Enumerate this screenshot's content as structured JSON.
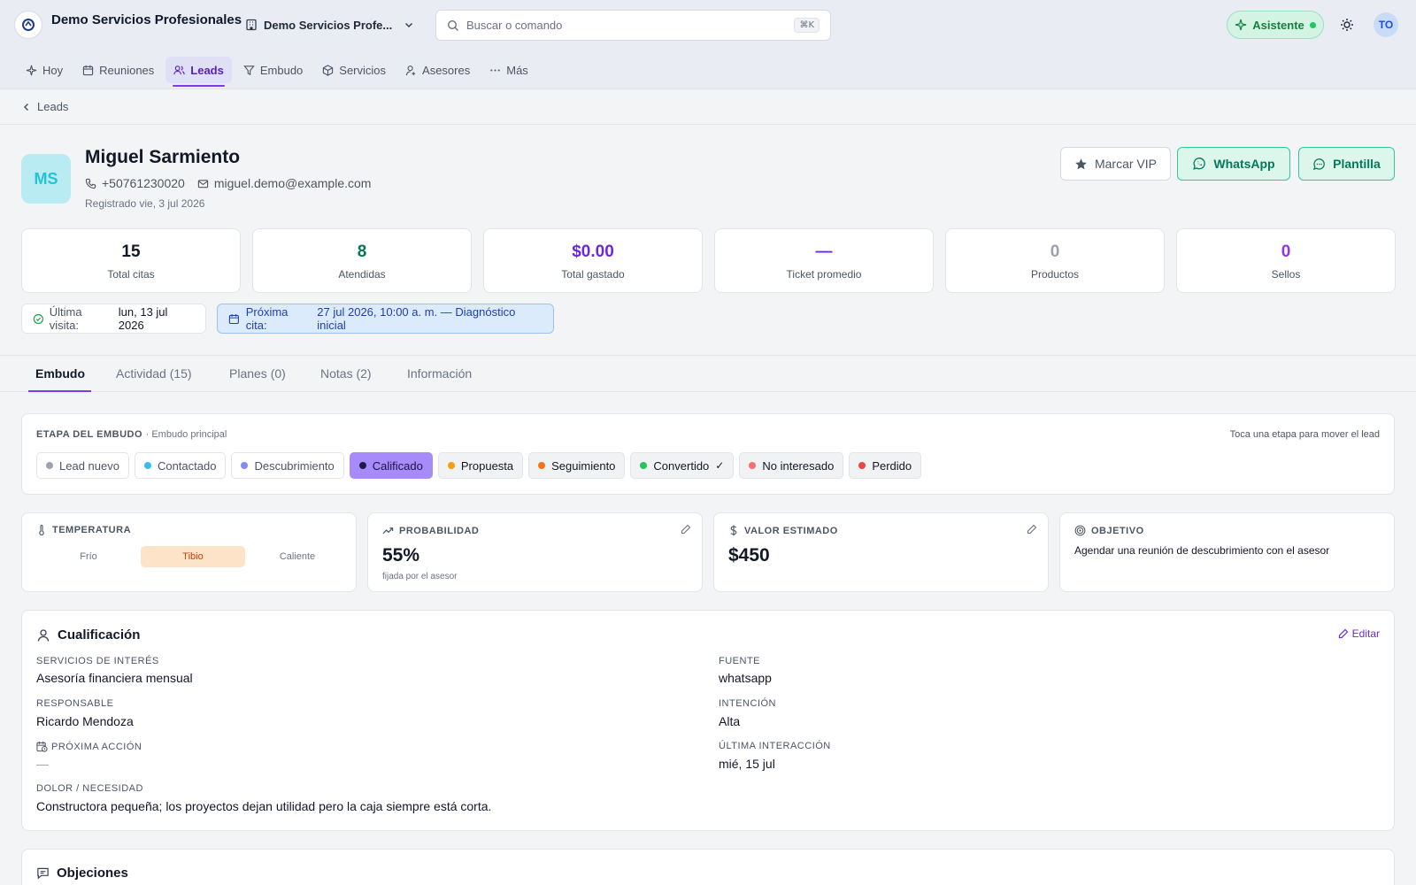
{
  "header": {
    "org_title": "Demo Servicios Profesionales",
    "org_switcher": "Demo Servicios Profe...",
    "search_placeholder": "Buscar o comando",
    "search_shortcut": "⌘K",
    "assistant_label": "Asistente",
    "user_initials": "TO"
  },
  "nav": {
    "items": [
      {
        "label": "Hoy",
        "icon": "sparkle-icon"
      },
      {
        "label": "Reuniones",
        "icon": "calendar-icon"
      },
      {
        "label": "Leads",
        "icon": "users-icon",
        "active": true
      },
      {
        "label": "Embudo",
        "icon": "funnel-icon"
      },
      {
        "label": "Servicios",
        "icon": "box-icon"
      },
      {
        "label": "Asesores",
        "icon": "user-icon"
      },
      {
        "label": "Más",
        "icon": "more-icon"
      }
    ]
  },
  "breadcrumb": {
    "back_label": "Leads"
  },
  "lead": {
    "initials": "MS",
    "name": "Miguel Sarmiento",
    "phone": "+50761230020",
    "email": "miguel.demo@example.com",
    "registered": "Registrado vie, 3 jul 2026"
  },
  "actions": {
    "vip": "Marcar VIP",
    "whatsapp": "WhatsApp",
    "template": "Plantilla"
  },
  "stats": [
    {
      "value": "15",
      "label": "Total citas",
      "color": "#111827"
    },
    {
      "value": "8",
      "label": "Atendidas",
      "color": "#047857"
    },
    {
      "value": "$0.00",
      "label": "Total gastado",
      "color": "#6d28d9"
    },
    {
      "value": "—",
      "label": "Ticket promedio",
      "color": "#6d28d9"
    },
    {
      "value": "0",
      "label": "Productos",
      "color": "#9ca3af"
    },
    {
      "value": "0",
      "label": "Sellos",
      "color": "#9333ea"
    }
  ],
  "visit": {
    "prefix": "Última visita:",
    "date": "lun, 13 jul 2026"
  },
  "next_appt": {
    "prefix": "Próxima cita:",
    "detail": "27 jul 2026, 10:00 a. m. — Diagnóstico inicial"
  },
  "tabs": [
    "Embudo",
    "Actividad (15)",
    "Planes (0)",
    "Notas (2)",
    "Información"
  ],
  "funnel": {
    "title": "ETAPA DEL EMBUDO",
    "subtitle": "· Embudo principal",
    "hint": "Toca una etapa para mover el lead",
    "stages": [
      {
        "label": "Lead nuevo",
        "color": "#9ca3af",
        "state": "past"
      },
      {
        "label": "Contactado",
        "color": "#38bdf8",
        "state": "past"
      },
      {
        "label": "Descubrimiento",
        "color": "#818cf8",
        "state": "past"
      },
      {
        "label": "Calificado",
        "color": "#1e1b4b",
        "state": "active"
      },
      {
        "label": "Propuesta",
        "color": "#f59e0b",
        "state": "future"
      },
      {
        "label": "Seguimiento",
        "color": "#f97316",
        "state": "future"
      },
      {
        "label": "Convertido",
        "color": "#22c55e",
        "state": "future",
        "check": "✓"
      },
      {
        "label": "No interesado",
        "color": "#f87171",
        "state": "future"
      },
      {
        "label": "Perdido",
        "color": "#ef4444",
        "state": "future"
      }
    ]
  },
  "temperature": {
    "title": "TEMPERATURA",
    "options": [
      "Frío",
      "Tibio",
      "Caliente"
    ],
    "selected": "Tibio"
  },
  "probability": {
    "title": "PROBABILIDAD",
    "value": "55%",
    "note": "fijada por el asesor"
  },
  "estimated_value": {
    "title": "VALOR ESTIMADO",
    "value": "$450"
  },
  "objective": {
    "title": "OBJETIVO",
    "text": "Agendar una reunión de descubrimiento con el asesor"
  },
  "qualification": {
    "title": "Cualificación",
    "edit_label": "Editar",
    "services_label": "SERVICIOS DE INTERÉS",
    "services_value": "Asesoría financiera mensual",
    "responsible_label": "RESPONSABLE",
    "responsible_value": "Ricardo Mendoza",
    "next_action_label": "PRÓXIMA ACCIÓN",
    "next_action_value": "—",
    "pain_label": "DOLOR / NECESIDAD",
    "pain_value": "Constructora pequeña; los proyectos dejan utilidad pero la caja siempre está corta.",
    "source_label": "FUENTE",
    "source_value": "whatsapp",
    "intent_label": "INTENCIÓN",
    "intent_value": "Alta",
    "last_interaction_label": "ÚLTIMA INTERACCIÓN",
    "last_interaction_value": "mié, 15 jul"
  },
  "objections": {
    "title": "Objeciones"
  }
}
